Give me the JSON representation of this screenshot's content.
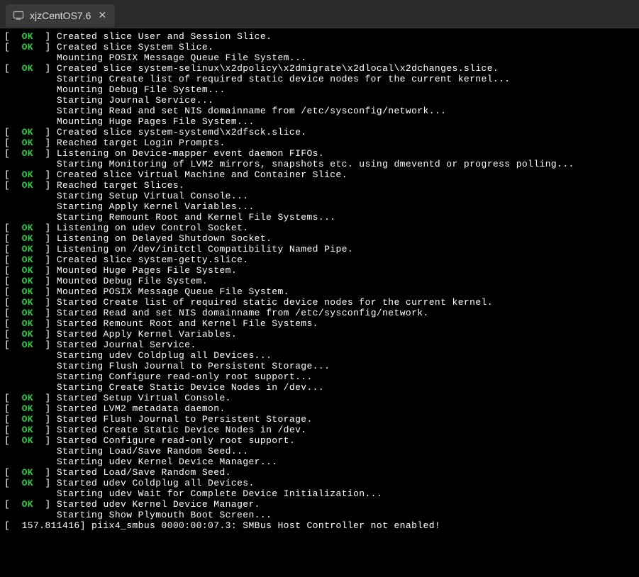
{
  "tab": {
    "title": "xjzCentOS7.6",
    "close_glyph": "✕"
  },
  "colors": {
    "ok": "#2ecc40",
    "text": "#ffffff",
    "background": "#000000"
  },
  "boot_lines": [
    {
      "status": "OK",
      "text": "Created slice User and Session Slice."
    },
    {
      "status": "OK",
      "text": "Created slice System Slice."
    },
    {
      "status": "",
      "text": "Mounting POSIX Message Queue File System..."
    },
    {
      "status": "OK",
      "text": "Created slice system-selinux\\x2dpolicy\\x2dmigrate\\x2dlocal\\x2dchanges.slice."
    },
    {
      "status": "",
      "text": "Starting Create list of required static device nodes for the current kernel..."
    },
    {
      "status": "",
      "text": "Mounting Debug File System..."
    },
    {
      "status": "",
      "text": "Starting Journal Service..."
    },
    {
      "status": "",
      "text": "Starting Read and set NIS domainname from /etc/sysconfig/network..."
    },
    {
      "status": "",
      "text": "Mounting Huge Pages File System..."
    },
    {
      "status": "OK",
      "text": "Created slice system-systemd\\x2dfsck.slice."
    },
    {
      "status": "OK",
      "text": "Reached target Login Prompts."
    },
    {
      "status": "OK",
      "text": "Listening on Device-mapper event daemon FIFOs."
    },
    {
      "status": "",
      "text": "Starting Monitoring of LVM2 mirrors, snapshots etc. using dmeventd or progress polling..."
    },
    {
      "status": "OK",
      "text": "Created slice Virtual Machine and Container Slice."
    },
    {
      "status": "OK",
      "text": "Reached target Slices."
    },
    {
      "status": "",
      "text": "Starting Setup Virtual Console..."
    },
    {
      "status": "",
      "text": "Starting Apply Kernel Variables..."
    },
    {
      "status": "",
      "text": "Starting Remount Root and Kernel File Systems..."
    },
    {
      "status": "OK",
      "text": "Listening on udev Control Socket."
    },
    {
      "status": "OK",
      "text": "Listening on Delayed Shutdown Socket."
    },
    {
      "status": "OK",
      "text": "Listening on /dev/initctl Compatibility Named Pipe."
    },
    {
      "status": "OK",
      "text": "Created slice system-getty.slice."
    },
    {
      "status": "OK",
      "text": "Mounted Huge Pages File System."
    },
    {
      "status": "OK",
      "text": "Mounted Debug File System."
    },
    {
      "status": "OK",
      "text": "Mounted POSIX Message Queue File System."
    },
    {
      "status": "OK",
      "text": "Started Create list of required static device nodes for the current kernel."
    },
    {
      "status": "OK",
      "text": "Started Read and set NIS domainname from /etc/sysconfig/network."
    },
    {
      "status": "OK",
      "text": "Started Remount Root and Kernel File Systems."
    },
    {
      "status": "OK",
      "text": "Started Apply Kernel Variables."
    },
    {
      "status": "OK",
      "text": "Started Journal Service."
    },
    {
      "status": "",
      "text": "Starting udev Coldplug all Devices..."
    },
    {
      "status": "",
      "text": "Starting Flush Journal to Persistent Storage..."
    },
    {
      "status": "",
      "text": "Starting Configure read-only root support..."
    },
    {
      "status": "",
      "text": "Starting Create Static Device Nodes in /dev..."
    },
    {
      "status": "OK",
      "text": "Started Setup Virtual Console."
    },
    {
      "status": "OK",
      "text": "Started LVM2 metadata daemon."
    },
    {
      "status": "OK",
      "text": "Started Flush Journal to Persistent Storage."
    },
    {
      "status": "OK",
      "text": "Started Create Static Device Nodes in /dev."
    },
    {
      "status": "OK",
      "text": "Started Configure read-only root support."
    },
    {
      "status": "",
      "text": "Starting Load/Save Random Seed..."
    },
    {
      "status": "",
      "text": "Starting udev Kernel Device Manager..."
    },
    {
      "status": "OK",
      "text": "Started Load/Save Random Seed."
    },
    {
      "status": "OK",
      "text": "Started udev Coldplug all Devices."
    },
    {
      "status": "",
      "text": "Starting udev Wait for Complete Device Initialization..."
    },
    {
      "status": "OK",
      "text": "Started udev Kernel Device Manager."
    },
    {
      "status": "",
      "text": "Starting Show Plymouth Boot Screen..."
    },
    {
      "status": "RAW",
      "text": "[  157.811416] piix4_smbus 0000:00:07.3: SMBus Host Controller not enabled!"
    }
  ]
}
